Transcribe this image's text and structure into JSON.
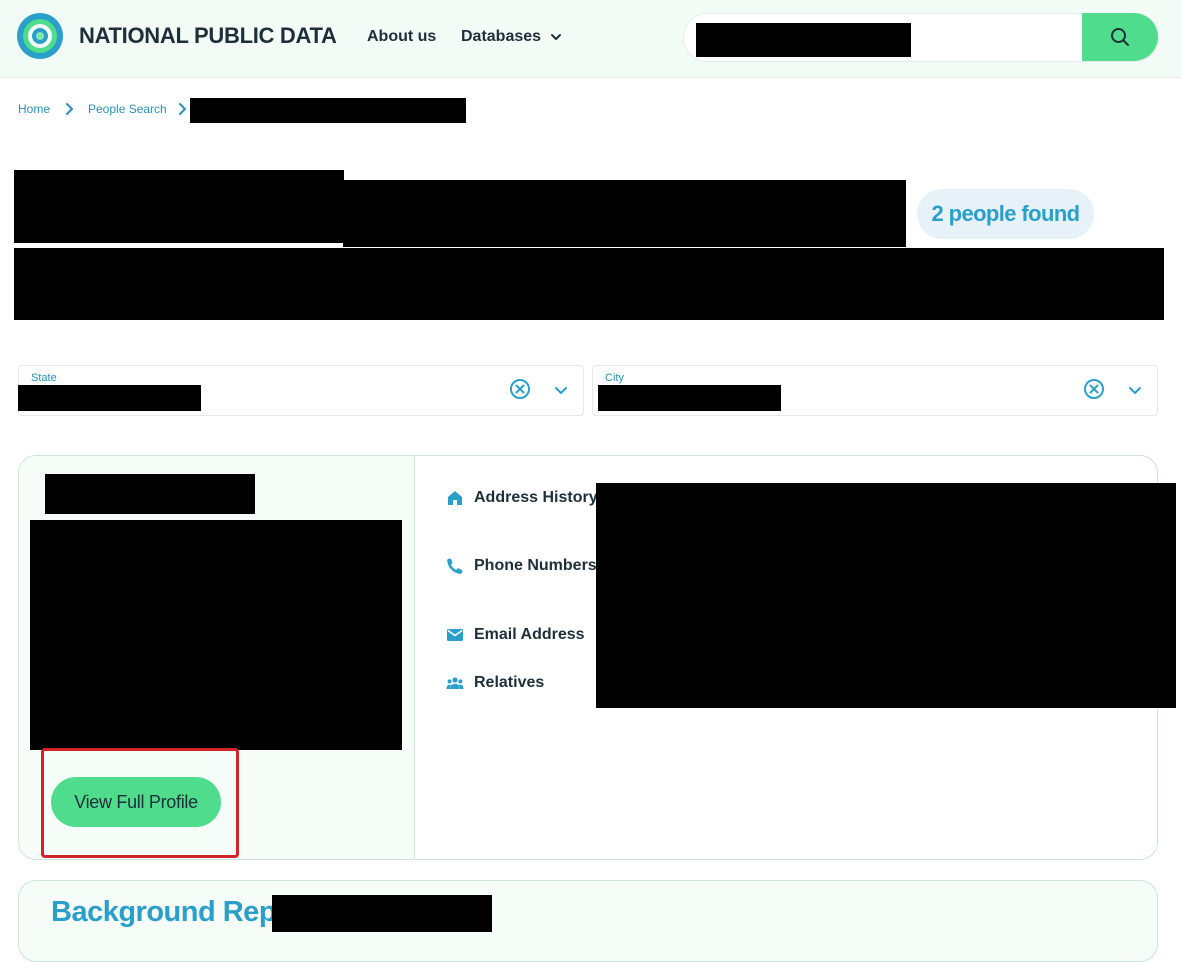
{
  "header": {
    "brand": "NATIONAL PUBLIC DATA",
    "nav": {
      "about": "About us",
      "databases": "Databases"
    },
    "search": {
      "icon": "search-icon"
    }
  },
  "breadcrumb": {
    "home": "Home",
    "people_search": "People Search"
  },
  "results": {
    "count_label": "2 people found"
  },
  "filters": {
    "state_label": "State",
    "city_label": "City"
  },
  "card": {
    "address_history": "Address History",
    "phone_numbers": "Phone Numbers",
    "email_address": "Email Address",
    "relatives": "Relatives",
    "view_profile": "View Full Profile"
  },
  "report": {
    "title": "Background Repo"
  },
  "colors": {
    "accent_green": "#4fdc8c",
    "accent_blue": "#2a9fc9",
    "highlight_red": "#d2242a"
  }
}
